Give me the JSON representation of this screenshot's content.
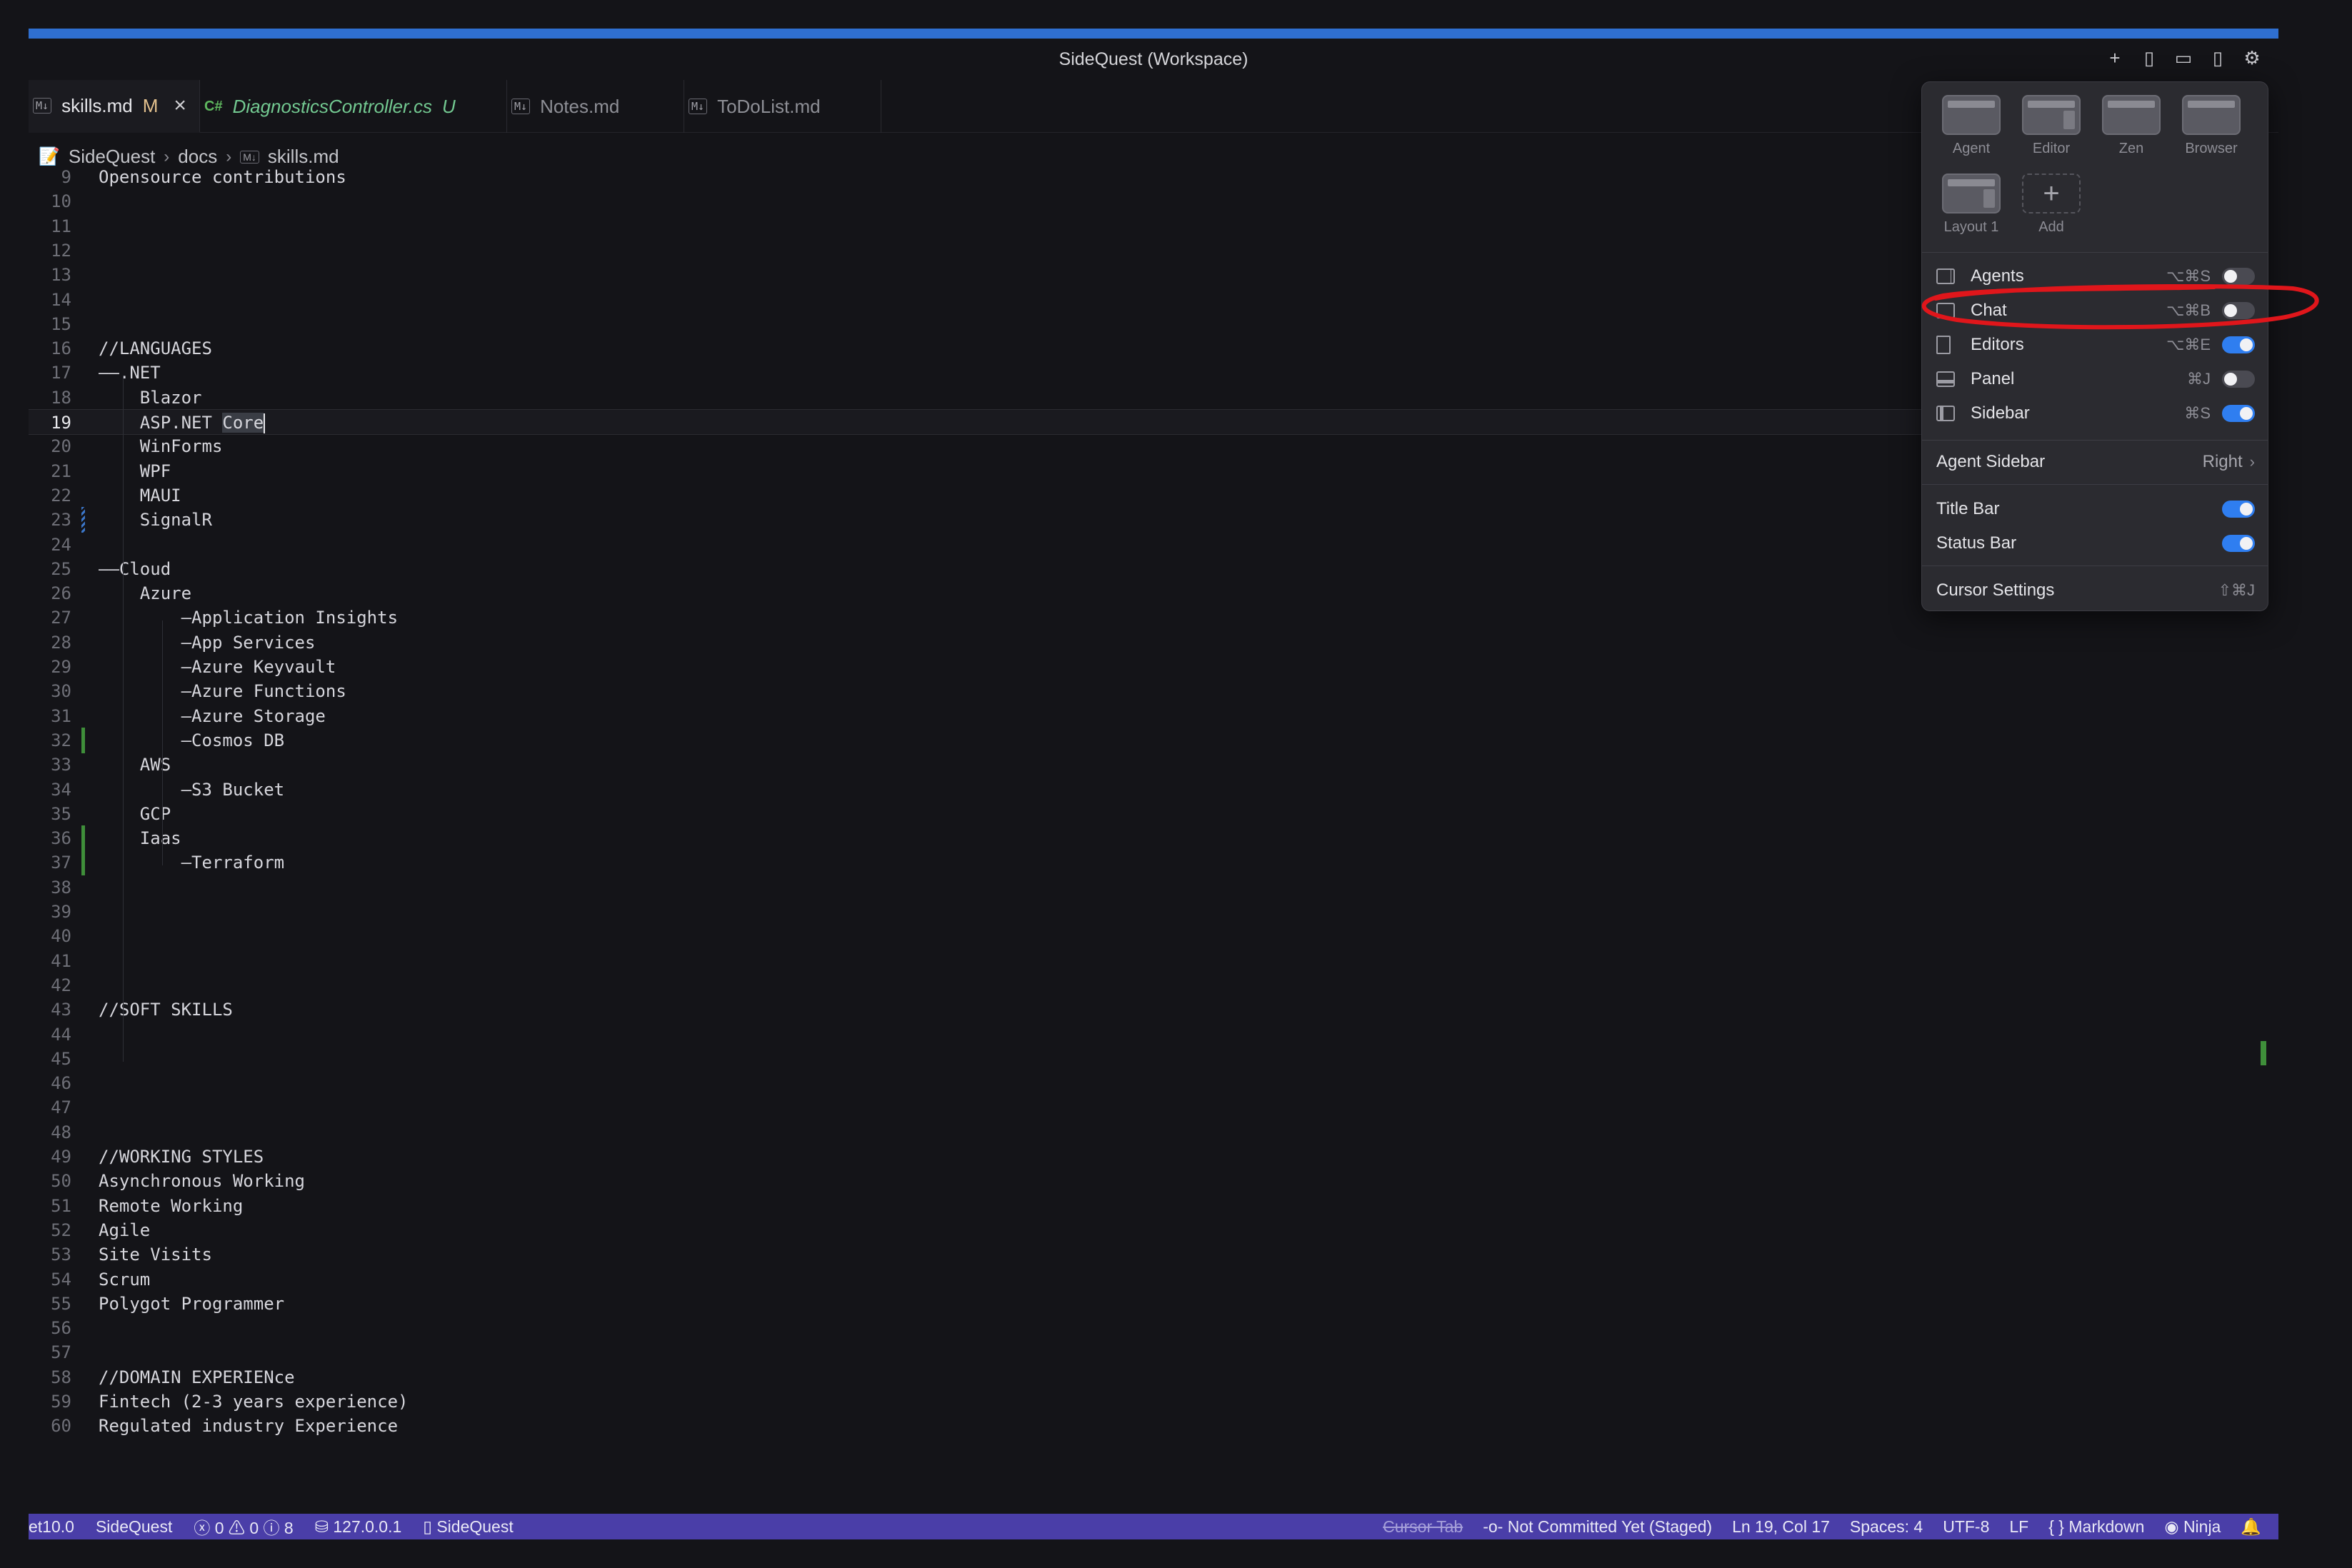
{
  "window": {
    "title": "SideQuest (Workspace)"
  },
  "title_actions": [
    {
      "name": "new-icon",
      "glyph": "+"
    },
    {
      "name": "toggle-sidebar-icon",
      "glyph": "▯"
    },
    {
      "name": "toggle-panel-icon",
      "glyph": "▭"
    },
    {
      "name": "toggle-secondary-sidebar-icon",
      "glyph": "▯"
    },
    {
      "name": "settings-gear-icon",
      "glyph": "⚙"
    }
  ],
  "tabs": [
    {
      "icon": "M↓",
      "label": "skills.md",
      "status": "M",
      "active": true
    },
    {
      "icon": "C#",
      "label": "DiagnosticsController.cs",
      "status": "U",
      "active": false
    },
    {
      "icon": "M↓",
      "label": "Notes.md",
      "status": "",
      "active": false
    },
    {
      "icon": "M↓",
      "label": "ToDoList.md",
      "status": "",
      "active": false
    }
  ],
  "breadcrumb": [
    "SideQuest",
    "docs",
    "skills.md"
  ],
  "editor": {
    "lines": [
      {
        "n": "9",
        "t": "Opensource contributions"
      },
      {
        "n": "10",
        "t": ""
      },
      {
        "n": "11",
        "t": ""
      },
      {
        "n": "12",
        "t": ""
      },
      {
        "n": "13",
        "t": ""
      },
      {
        "n": "14",
        "t": ""
      },
      {
        "n": "15",
        "t": ""
      },
      {
        "n": "16",
        "t": "//LANGUAGES"
      },
      {
        "n": "17",
        "t": "——.NET"
      },
      {
        "n": "18",
        "t": "    Blazor"
      },
      {
        "n": "19",
        "t": "    ASP.NET "
      },
      {
        "n": "20",
        "t": "    WinForms"
      },
      {
        "n": "21",
        "t": "    WPF"
      },
      {
        "n": "22",
        "t": "    MAUI"
      },
      {
        "n": "23",
        "t": "    SignalR"
      },
      {
        "n": "24",
        "t": ""
      },
      {
        "n": "25",
        "t": "——Cloud"
      },
      {
        "n": "26",
        "t": "    Azure"
      },
      {
        "n": "27",
        "t": "        —Application Insights"
      },
      {
        "n": "28",
        "t": "        —App Services"
      },
      {
        "n": "29",
        "t": "        —Azure Keyvault"
      },
      {
        "n": "30",
        "t": "        —Azure Functions"
      },
      {
        "n": "31",
        "t": "        —Azure Storage"
      },
      {
        "n": "32",
        "t": "        —Cosmos DB"
      },
      {
        "n": "33",
        "t": "    AWS"
      },
      {
        "n": "34",
        "t": "        —S3 Bucket"
      },
      {
        "n": "35",
        "t": "    GCP"
      },
      {
        "n": "36",
        "t": "    Iaas"
      },
      {
        "n": "37",
        "t": "        —Terraform"
      },
      {
        "n": "38",
        "t": ""
      },
      {
        "n": "39",
        "t": ""
      },
      {
        "n": "40",
        "t": ""
      },
      {
        "n": "41",
        "t": ""
      },
      {
        "n": "42",
        "t": ""
      },
      {
        "n": "43",
        "t": "//SOFT SKILLS"
      },
      {
        "n": "44",
        "t": ""
      },
      {
        "n": "45",
        "t": ""
      },
      {
        "n": "46",
        "t": ""
      },
      {
        "n": "47",
        "t": ""
      },
      {
        "n": "48",
        "t": ""
      },
      {
        "n": "49",
        "t": "//WORKING STYLES"
      },
      {
        "n": "50",
        "t": "Asynchronous Working"
      },
      {
        "n": "51",
        "t": "Remote Working"
      },
      {
        "n": "52",
        "t": "Agile"
      },
      {
        "n": "53",
        "t": "Site Visits"
      },
      {
        "n": "54",
        "t": "Scrum"
      },
      {
        "n": "55",
        "t": "Polygot Programmer"
      },
      {
        "n": "56",
        "t": ""
      },
      {
        "n": "57",
        "t": ""
      },
      {
        "n": "58",
        "t": "//DOMAIN EXPERIENce"
      },
      {
        "n": "59",
        "t": "Fintech (2-3 years experience)"
      },
      {
        "n": "60",
        "t": "Regulated industry Experience"
      }
    ],
    "selected_word": "Core",
    "current_line": "19"
  },
  "layout_menu": {
    "layouts": [
      "Agent",
      "Editor",
      "Zen",
      "Browser",
      "Layout 1",
      "Add"
    ],
    "toggles": [
      {
        "label": "Agents",
        "shortcut": "⌥⌘S",
        "on": false,
        "icon": "agents-panel-icon"
      },
      {
        "label": "Chat",
        "shortcut": "⌥⌘B",
        "on": false,
        "icon": "chat-icon"
      },
      {
        "label": "Editors",
        "shortcut": "⌥⌘E",
        "on": true,
        "icon": "file-icon"
      },
      {
        "label": "Panel",
        "shortcut": "⌘J",
        "on": false,
        "icon": "panel-icon"
      },
      {
        "label": "Sidebar",
        "shortcut": "⌘S",
        "on": true,
        "icon": "sidebar-icon"
      }
    ],
    "agent_sidebar": {
      "label": "Agent Sidebar",
      "value": "Right"
    },
    "bars": [
      {
        "label": "Title Bar",
        "on": true
      },
      {
        "label": "Status Bar",
        "on": true
      }
    ],
    "cursor_settings": {
      "label": "Cursor Settings",
      "shortcut": "⇧⌘J"
    }
  },
  "statusbar": {
    "left": [
      "et10.0",
      "SideQuest",
      "ⓧ 0 ⚠ 0 ⓘ 8",
      "127.0.0.1",
      "SideQuest"
    ],
    "right": [
      "Cursor Tab",
      "Not Committed Yet (Staged)",
      "Ln 19, Col 17",
      "Spaces: 4",
      "UTF-8",
      "LF",
      "{ } Markdown",
      "Ninja"
    ]
  },
  "colors": {
    "accent": "#2f7ef0",
    "statusbar": "#4a3ea8",
    "annotation": "#e0161b",
    "titlebar_stripe": "#2f6fd0"
  }
}
